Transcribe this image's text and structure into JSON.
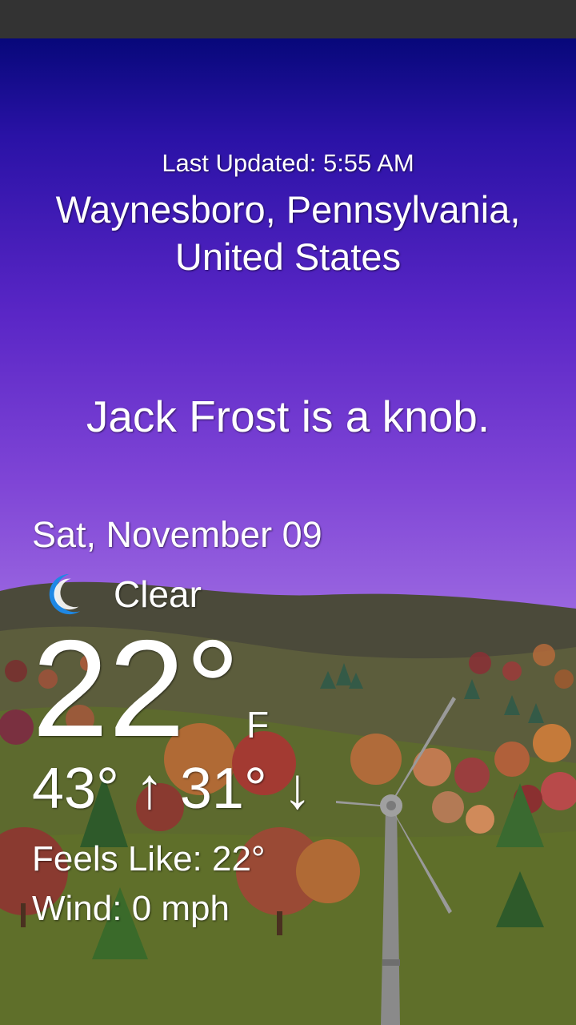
{
  "weather": {
    "last_updated": "Last Updated: 5:55 AM",
    "location_line1": "Waynesboro, Pennsylvania,",
    "location_line2": "United States",
    "joke": "Jack Frost is a knob.",
    "date": "Sat, November 09",
    "condition": "Clear",
    "condition_icon": "crescent-moon-icon",
    "temperature": "22°",
    "unit": "F",
    "hi_lo": "43° ↑ 31° ↓",
    "feels_like": "Feels Like: 22°",
    "wind": "Wind: 0 mph"
  },
  "colors": {
    "sky_top": "#07087a",
    "sky_bottom": "#b79af0",
    "moon": "#1e88e5",
    "text": "#ffffff"
  }
}
